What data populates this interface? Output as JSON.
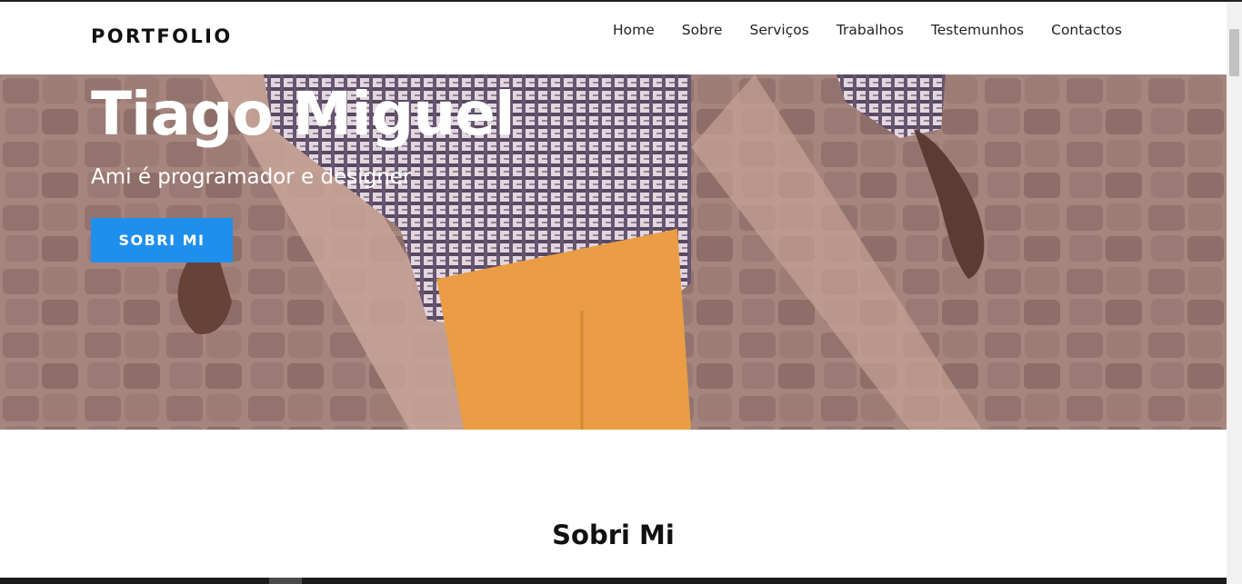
{
  "header": {
    "logo": "PORTFOLIO",
    "nav": [
      "Home",
      "Sobre",
      "Serviços",
      "Trabalhos",
      "Testemunhos",
      "Contactos"
    ]
  },
  "hero": {
    "title": "Tiago Miguel",
    "subtitle": "Ami é programador e designer",
    "button_label": "SOBRI MI"
  },
  "about": {
    "title": "Sobri Mi"
  },
  "colors": {
    "accent": "#1f8fee",
    "text_dark": "#111111",
    "hero_text": "#ffffff"
  }
}
